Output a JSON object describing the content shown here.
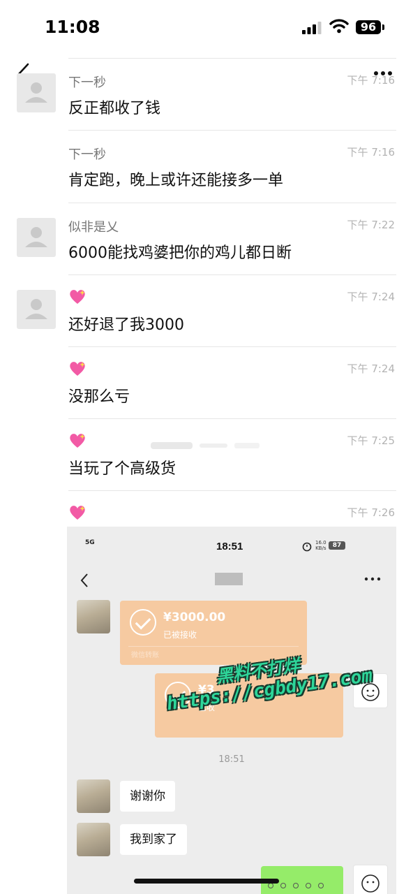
{
  "status_bar": {
    "time": "11:08",
    "battery": "96"
  },
  "messages": [
    {
      "name": "下一秒",
      "time": "下午 7:16",
      "text": "反正都收了钱",
      "avatar": true,
      "sender_type": "text"
    },
    {
      "name": "下一秒",
      "time": "下午 7:16",
      "text": "肯定跑，晚上或许还能接多一单",
      "avatar": false,
      "sender_type": "text"
    },
    {
      "name": "似非是乂",
      "time": "下午 7:22",
      "text": "6000能找鸡婆把你的鸡儿都日断",
      "avatar": true,
      "sender_type": "text"
    },
    {
      "name": "",
      "time": "下午 7:24",
      "text": "还好退了我3000",
      "avatar": true,
      "sender_type": "heart-emoji"
    },
    {
      "name": "",
      "time": "下午 7:24",
      "text": "没那么亏",
      "avatar": false,
      "sender_type": "heart-emoji"
    },
    {
      "name": "",
      "time": "下午 7:25",
      "text": "当玩了个高级货",
      "avatar": false,
      "sender_type": "heart-emoji"
    },
    {
      "name": "",
      "time": "下午 7:26",
      "text": "",
      "avatar": false,
      "sender_type": "heart-emoji"
    }
  ],
  "embedded_screenshot": {
    "status_time": "18:51",
    "signal": "5G",
    "speed": "16.0",
    "speed_unit": "KB/s",
    "battery": "87",
    "transfer_1": {
      "amount": "¥3000.00",
      "status": "已被接收",
      "footer": "微信转账"
    },
    "transfer_2": {
      "amount": "¥3",
      "status": "已收"
    },
    "center_time": "18:51",
    "bubble_1": "谢谢你",
    "bubble_2": "我到家了"
  },
  "watermark": {
    "line1": "黑料不打烊",
    "line2": "https://cgbdy17.com"
  },
  "colors": {
    "transfer": "#f6caa1",
    "green_bubble": "#95ec69",
    "watermark": "#2ed69a"
  }
}
